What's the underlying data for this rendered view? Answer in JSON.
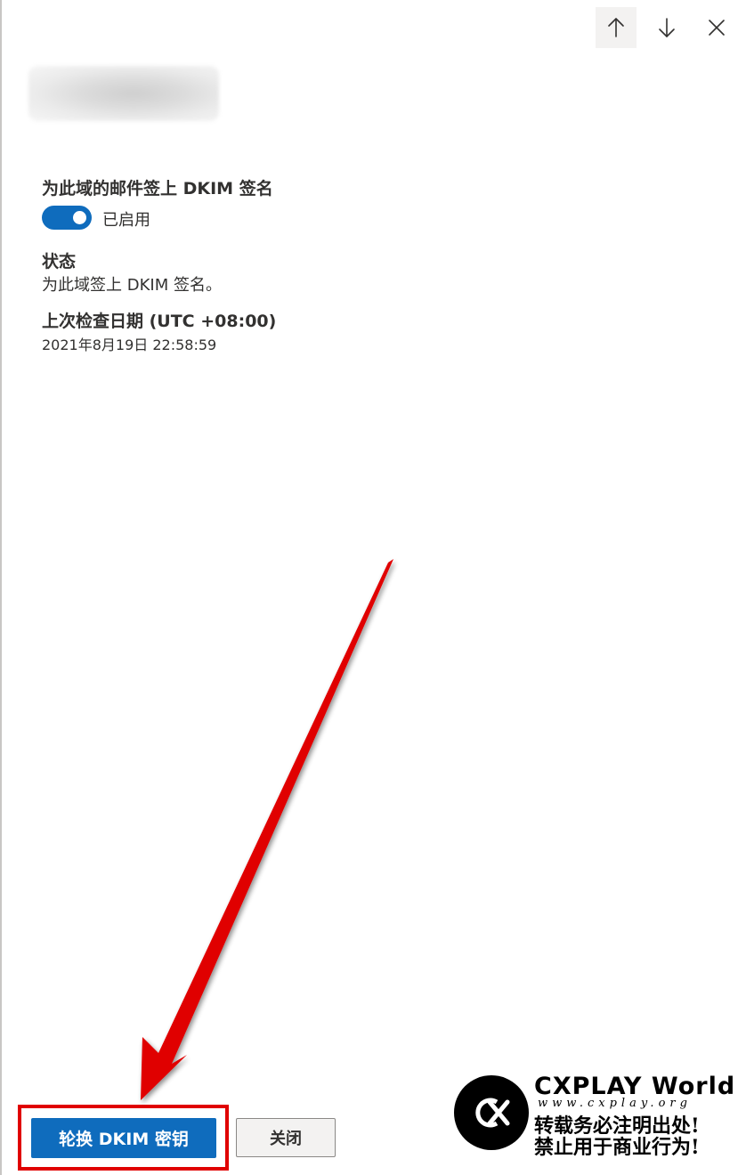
{
  "panel": {
    "dkim_sign_label": "为此域的邮件签上 DKIM 签名",
    "toggle_state_label": "已启用",
    "toggle_on": true,
    "status_label": "状态",
    "status_value": "为此域签上 DKIM 签名。",
    "last_checked_label": "上次检查日期 (UTC +08:00)",
    "last_checked_value": "2021年8月19日 22:58:59"
  },
  "nav": {
    "up_icon": "arrow-up-icon",
    "down_icon": "arrow-down-icon",
    "close_icon": "close-icon"
  },
  "footer": {
    "rotate_button_label": "轮换 DKIM 密钥",
    "close_button_label": "关闭"
  },
  "watermark": {
    "title": "CXPLAY World",
    "url": "www.cxplay.org",
    "line1": "转载务必注明出处!",
    "line2": "禁止用于商业行为!"
  },
  "colors": {
    "accent": "#0f6cbd",
    "annotation_red": "#e00000"
  }
}
